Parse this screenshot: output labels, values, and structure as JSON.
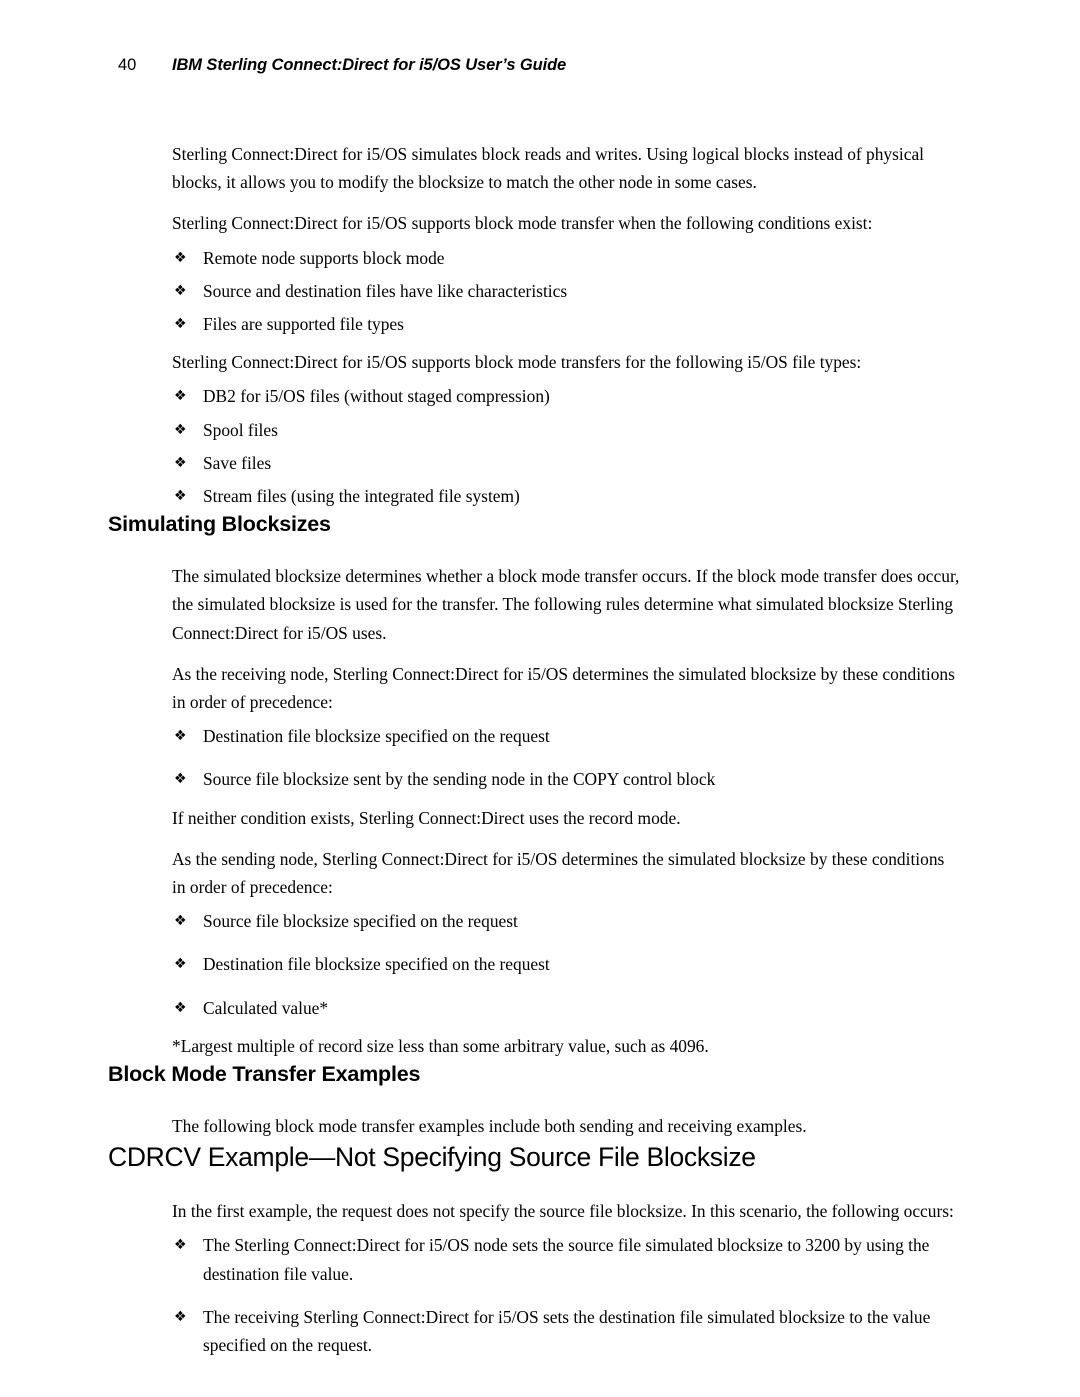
{
  "header": {
    "page_number": "40",
    "title": "IBM Sterling Connect:Direct for i5/OS User’s Guide"
  },
  "bullet_glyph": "❖",
  "body": {
    "intro_para_1": "Sterling Connect:Direct for i5/OS simulates block reads and writes. Using logical blocks instead of physical blocks, it allows you to modify the blocksize to match the other node in some cases.",
    "intro_para_2": "Sterling Connect:Direct for i5/OS supports block mode transfer when the following conditions exist:",
    "conditions_list": [
      "Remote node supports block mode",
      "Source and destination files have like characteristics",
      "Files are supported file types"
    ],
    "filetypes_intro": "Sterling Connect:Direct for i5/OS supports block mode transfers for the following i5/OS file types:",
    "filetypes_list": [
      "DB2 for i5/OS files (without staged compression)",
      "Spool files",
      "Save files",
      "Stream files (using the integrated file system)"
    ]
  },
  "simulating_blocksizes": {
    "heading": "Simulating Blocksizes",
    "para_1": "The simulated blocksize determines whether a block mode transfer occurs. If the block mode transfer does occur, the simulated blocksize is used for the transfer. The following rules determine what simulated blocksize Sterling Connect:Direct for i5/OS uses.",
    "para_2": "As the receiving node, Sterling Connect:Direct for i5/OS determines the simulated blocksize by these conditions in order of precedence:",
    "receiving_list": [
      "Destination file blocksize specified on the request",
      "Source file blocksize sent by the sending node in the COPY control block"
    ],
    "para_3": "If neither condition exists, Sterling Connect:Direct uses the record mode.",
    "para_4": "As the sending node, Sterling Connect:Direct for i5/OS determines the simulated blocksize by these conditions in order of precedence:",
    "sending_list": [
      "Source file blocksize specified on the request",
      "Destination file blocksize specified on the request",
      "Calculated value*"
    ],
    "footnote": "*Largest multiple of record size less than some arbitrary value, such as 4096."
  },
  "block_mode_examples": {
    "heading": "Block Mode Transfer Examples",
    "para_1": "The following block mode transfer examples include both sending and receiving examples."
  },
  "cdrcv_example": {
    "heading": "CDRCV Example—Not Specifying Source File Blocksize",
    "para_1": "In the first example, the request does not specify the source file blocksize. In this scenario, the following occurs:",
    "list": [
      "The Sterling Connect:Direct for i5/OS node sets the source file simulated blocksize to 3200 by using the destination file value.",
      "The receiving Sterling Connect:Direct for i5/OS sets the destination file simulated blocksize to the value specified on the request."
    ]
  }
}
